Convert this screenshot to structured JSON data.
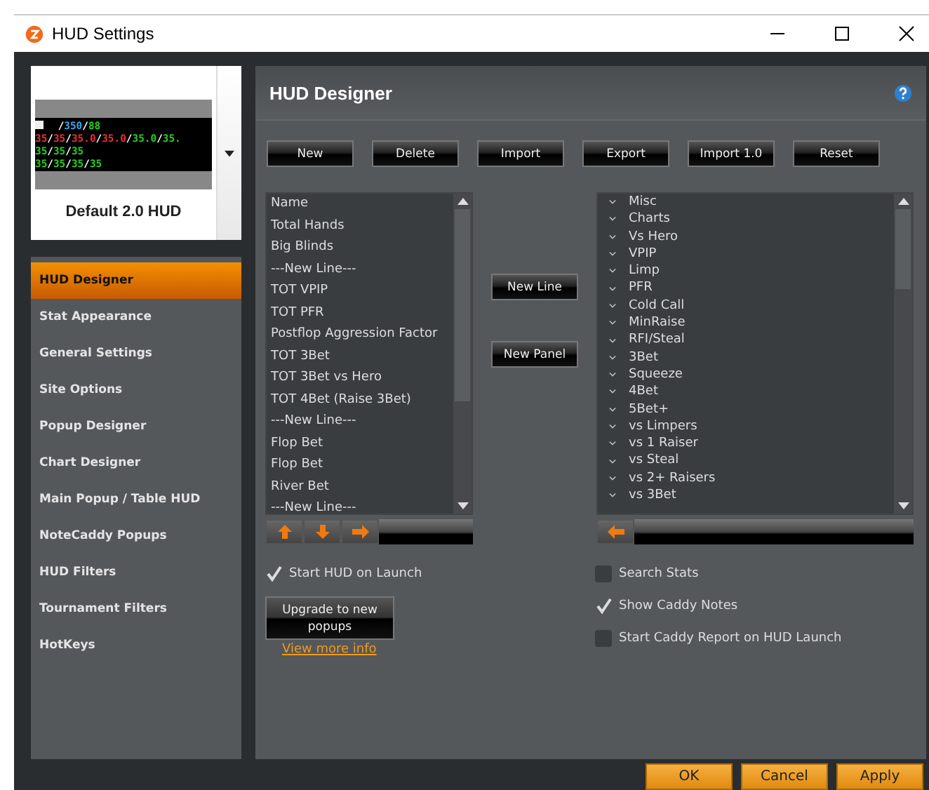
{
  "window": {
    "title": "HUD Settings"
  },
  "hud_preview": {
    "lines": [
      [
        {
          "text": "/",
          "color": "#ffffff"
        },
        {
          "text": "350",
          "color": "#3aa6e8"
        },
        {
          "text": "/",
          "color": "#ffffff"
        },
        {
          "text": "88",
          "color": "#22d022"
        }
      ],
      [
        {
          "text": "35",
          "color": "#e83030"
        },
        {
          "text": "/",
          "color": "#ffffff"
        },
        {
          "text": "35",
          "color": "#e83030"
        },
        {
          "text": "/",
          "color": "#ffffff"
        },
        {
          "text": "35.0",
          "color": "#e83030"
        },
        {
          "text": "/",
          "color": "#ffffff"
        },
        {
          "text": "35.0",
          "color": "#e83030"
        },
        {
          "text": "/",
          "color": "#ffffff"
        },
        {
          "text": "35.0",
          "color": "#22d022"
        },
        {
          "text": "/",
          "color": "#ffffff"
        },
        {
          "text": "35.",
          "color": "#22d022"
        }
      ],
      [
        {
          "text": "35",
          "color": "#22d022"
        },
        {
          "text": "/",
          "color": "#ffffff"
        },
        {
          "text": "35",
          "color": "#22d022"
        },
        {
          "text": "/",
          "color": "#ffffff"
        },
        {
          "text": "35",
          "color": "#22d022"
        }
      ],
      [
        {
          "text": "35",
          "color": "#22d022"
        },
        {
          "text": "/",
          "color": "#ffffff"
        },
        {
          "text": "35",
          "color": "#22d022"
        },
        {
          "text": "/",
          "color": "#ffffff"
        },
        {
          "text": "35",
          "color": "#22d022"
        },
        {
          "text": "/",
          "color": "#ffffff"
        },
        {
          "text": "35",
          "color": "#22d022"
        }
      ]
    ],
    "name": "Default 2.0 HUD"
  },
  "sidebar": {
    "items": [
      {
        "label": "HUD Designer",
        "selected": true
      },
      {
        "label": "Stat Appearance",
        "selected": false
      },
      {
        "label": "General Settings",
        "selected": false
      },
      {
        "label": "Site Options",
        "selected": false
      },
      {
        "label": "Popup Designer",
        "selected": false
      },
      {
        "label": "Chart Designer",
        "selected": false
      },
      {
        "label": "Main Popup / Table HUD",
        "selected": false
      },
      {
        "label": "NoteCaddy Popups",
        "selected": false
      },
      {
        "label": "HUD Filters",
        "selected": false
      },
      {
        "label": "Tournament Filters",
        "selected": false
      },
      {
        "label": "HotKeys",
        "selected": false
      }
    ]
  },
  "panel": {
    "title": "HUD Designer",
    "toolbar": [
      "New",
      "Delete",
      "Import",
      "Export",
      "Import 1.0",
      "Reset"
    ],
    "hud_stats": [
      "Name",
      "Total Hands",
      "Big Blinds",
      "---New Line---",
      "TOT VPIP",
      "TOT PFR",
      "Postflop Aggression Factor",
      "TOT 3Bet",
      "TOT 3Bet vs Hero",
      "TOT 4Bet (Raise 3Bet)",
      "---New Line---",
      "Flop Bet",
      "Flop Bet",
      "River Bet",
      "---New Line---"
    ],
    "middle_buttons": [
      "New Line",
      "New Panel"
    ],
    "stat_categories": [
      "Misc",
      "Charts",
      "Vs Hero",
      "VPIP",
      "Limp",
      "PFR",
      "Cold Call",
      "MinRaise",
      "RFI/Steal",
      "3Bet",
      "Squeeze",
      "4Bet",
      "5Bet+",
      "vs Limpers",
      "vs 1 Raiser",
      "vs Steal",
      "vs 2+ Raisers",
      "vs 3Bet"
    ],
    "left_options": [
      {
        "label": "Start HUD on Launch",
        "checked": true
      }
    ],
    "upgrade_button": "Upgrade to new popups",
    "more_info_link": "View more info",
    "right_options": [
      {
        "label": "Search Stats",
        "checked": false
      },
      {
        "label": "Show Caddy Notes",
        "checked": true
      },
      {
        "label": "Start Caddy Report on HUD Launch",
        "checked": false
      }
    ]
  },
  "footer_buttons": [
    "OK",
    "Cancel",
    "Apply"
  ]
}
